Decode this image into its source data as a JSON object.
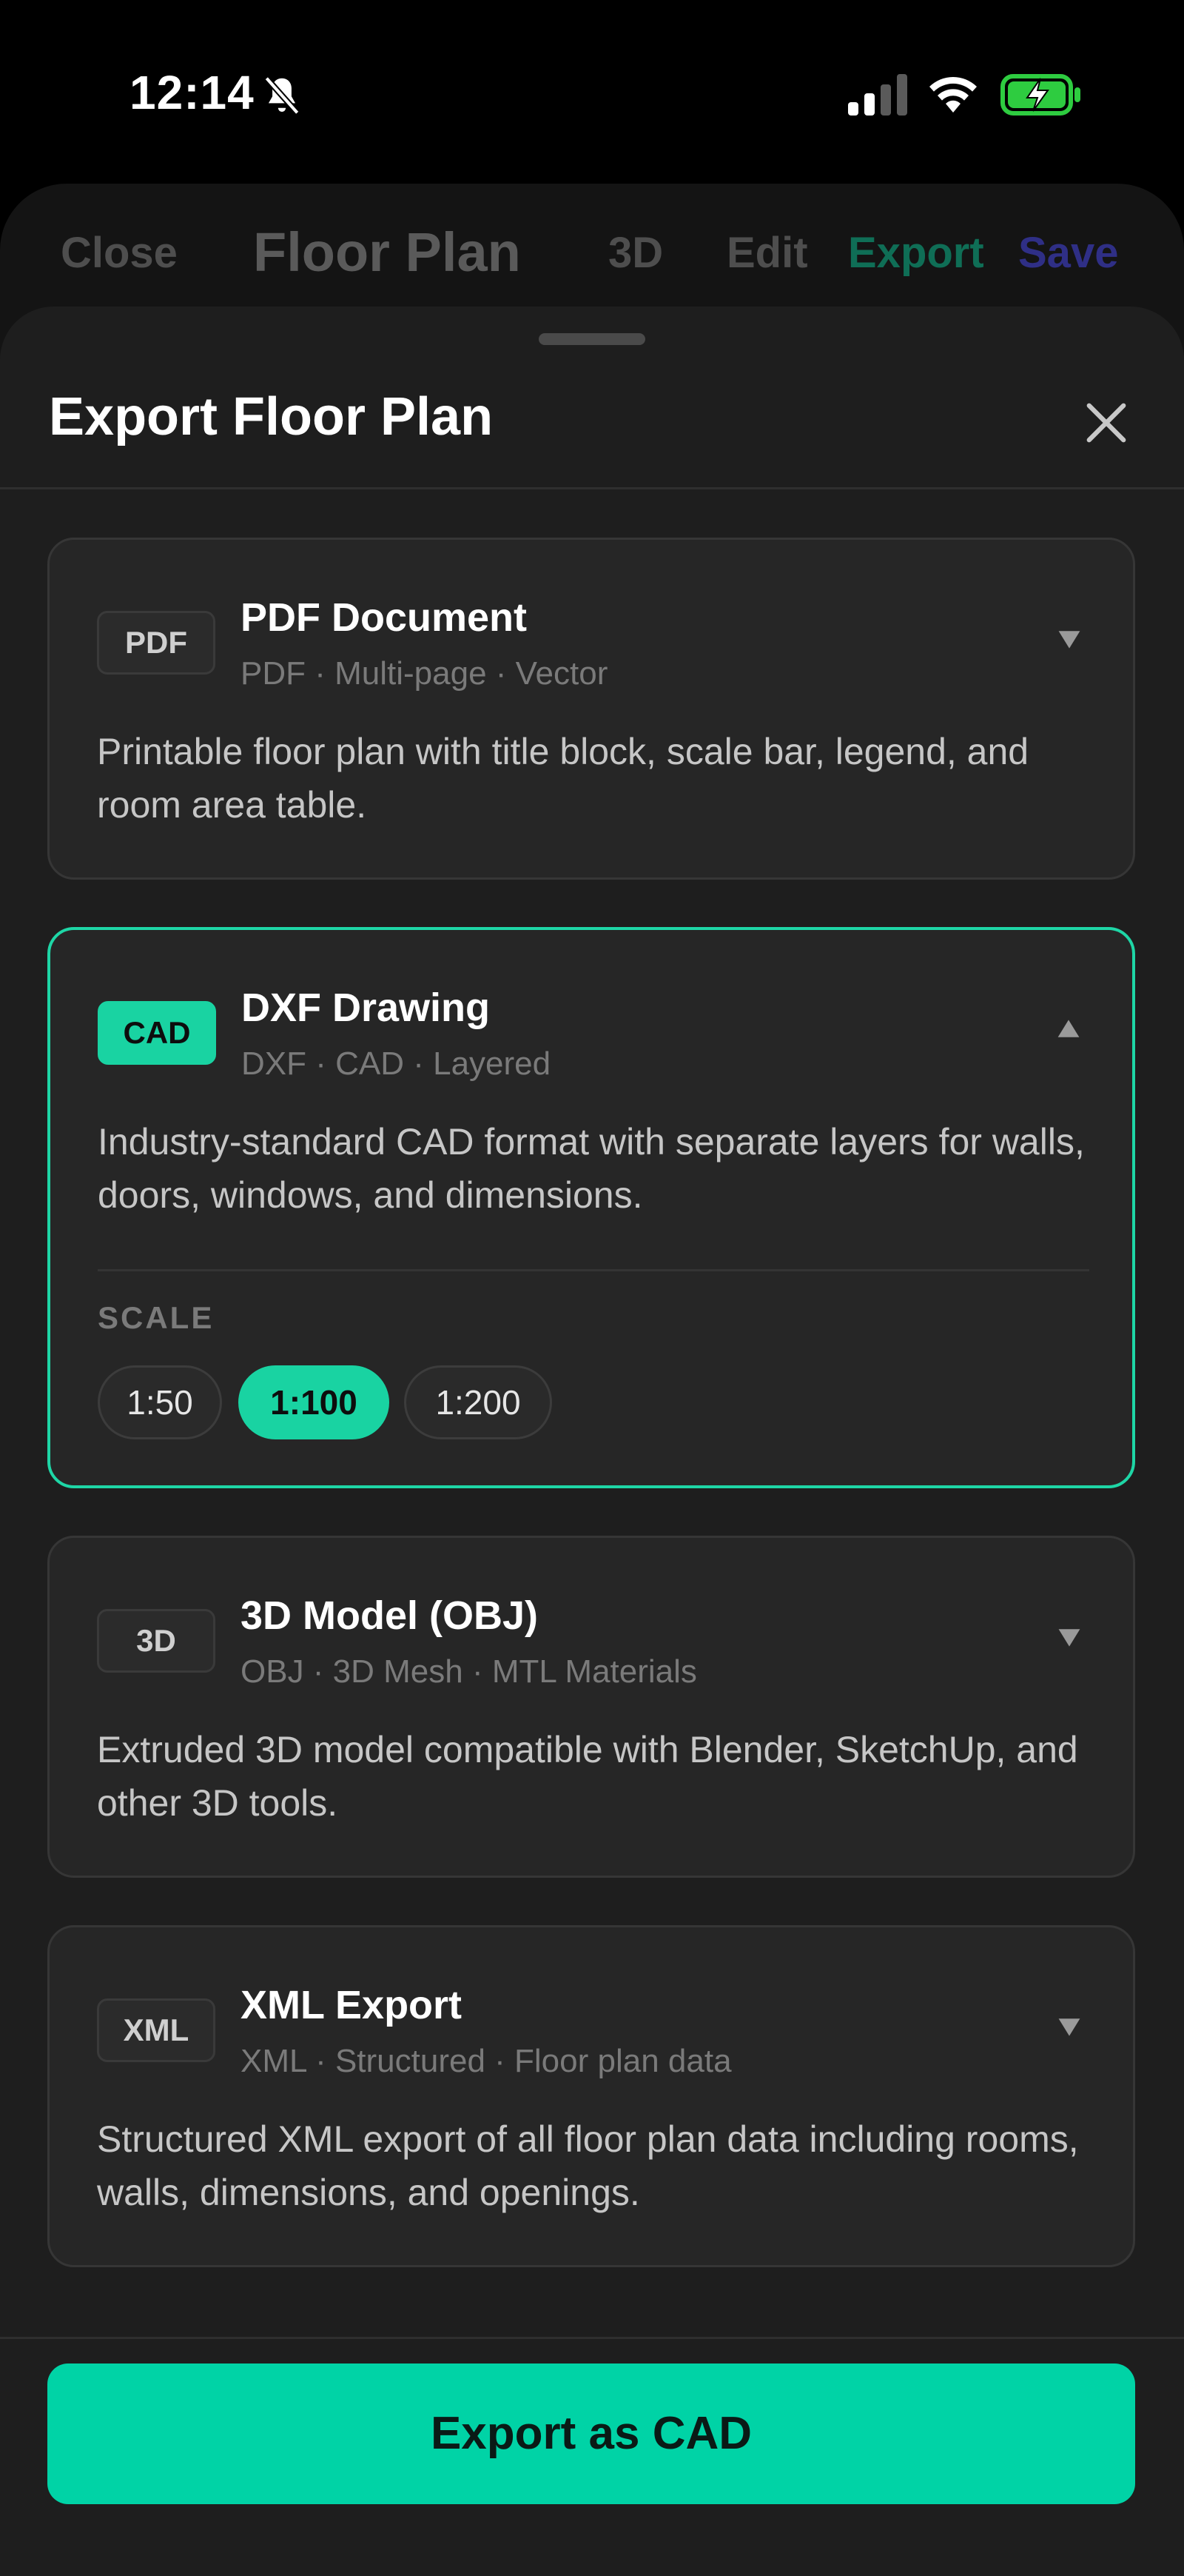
{
  "status_bar": {
    "time": "12:14"
  },
  "background_nav": {
    "close": "Close",
    "title": "Floor Plan",
    "view_3d": "3D",
    "edit": "Edit",
    "export": "Export",
    "save": "Save"
  },
  "sheet": {
    "title": "Export Floor Plan",
    "cards": [
      {
        "badge": "PDF",
        "title": "PDF Document",
        "meta": "PDF · Multi-page · Vector",
        "desc": "Printable floor plan with title block, scale bar, legend, and room area table.",
        "expanded": false
      },
      {
        "badge": "CAD",
        "title": "DXF Drawing",
        "meta": "DXF · CAD · Layered",
        "desc": "Industry-standard CAD format with separate layers for walls, doors, windows, and dimensions.",
        "expanded": true,
        "scale_label": "SCALE",
        "scales": [
          "1:50",
          "1:100",
          "1:200"
        ],
        "selected_scale": "1:100"
      },
      {
        "badge": "3D",
        "title": "3D Model (OBJ)",
        "meta": "OBJ · 3D Mesh · MTL Materials",
        "desc": "Extruded 3D model compatible with Blender, SketchUp, and other 3D tools.",
        "expanded": false
      },
      {
        "badge": "XML",
        "title": "XML Export",
        "meta": "XML · Structured · Floor plan data",
        "desc": "Structured XML export of all floor plan data including rooms, walls, dimensions, and openings.",
        "expanded": false
      }
    ],
    "export_button": "Export as CAD"
  },
  "colors": {
    "accent": "#00d3a6",
    "sheet_bg": "#1e1e1e",
    "card_bg": "#262626"
  }
}
